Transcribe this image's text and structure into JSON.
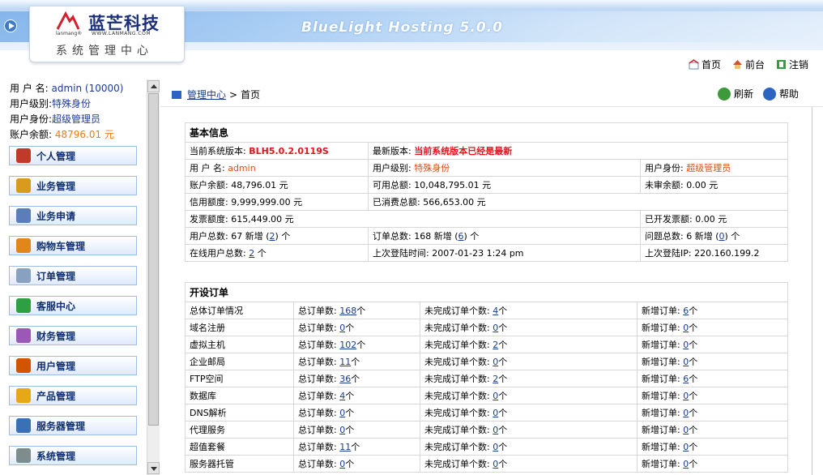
{
  "header": {
    "app_title": "BlueLight Hosting 5.0.0",
    "logo_brand": "蓝芒科技",
    "logo_small": "lanmang®",
    "logo_url": "WWW.LANMANG.COM",
    "logo_sub": "系统管理中心"
  },
  "top_links": [
    {
      "label": "首页",
      "icon": "home-icon"
    },
    {
      "label": "前台",
      "icon": "house-icon"
    },
    {
      "label": "注销",
      "icon": "logout-icon"
    }
  ],
  "sidebar": {
    "user": [
      {
        "label": "用 户 名:",
        "value": "admin (10000)"
      },
      {
        "label": "用户级别:",
        "value": "特殊身份"
      },
      {
        "label": "用户身份:",
        "value": "超级管理员"
      },
      {
        "label": "账户余额:",
        "value": "48796.01 元"
      }
    ],
    "menu": [
      {
        "label": "个人管理",
        "icon": "person-icon",
        "color": "#c0392b"
      },
      {
        "label": "业务管理",
        "icon": "box-icon",
        "color": "#d99b1e"
      },
      {
        "label": "业务申请",
        "icon": "hand-icon",
        "color": "#5c7db8"
      },
      {
        "label": "购物车管理",
        "icon": "cart-icon",
        "color": "#e0861a"
      },
      {
        "label": "订单管理",
        "icon": "notepad-icon",
        "color": "#8aa0bf"
      },
      {
        "label": "客服中心",
        "icon": "check-icon",
        "color": "#2ea043"
      },
      {
        "label": "财务管理",
        "icon": "money-icon",
        "color": "#9b59b6"
      },
      {
        "label": "用户管理",
        "icon": "users-icon",
        "color": "#d35400"
      },
      {
        "label": "产品管理",
        "icon": "award-icon",
        "color": "#e6a817"
      },
      {
        "label": "服务器管理",
        "icon": "server-icon",
        "color": "#3d6fb5"
      },
      {
        "label": "系统管理",
        "icon": "tools-icon",
        "color": "#7f8c8d"
      }
    ]
  },
  "breadcrumb": {
    "link": "管理中心",
    "sep": ">",
    "current": "首页"
  },
  "actions": [
    {
      "label": "刷新",
      "icon": "refresh-icon"
    },
    {
      "label": "帮助",
      "icon": "help-icon"
    }
  ],
  "basic_info": {
    "title": "基本信息",
    "cur_version_label": "当前系统版本:",
    "cur_version": "BLH5.0.2.0119S",
    "latest_label": "最新版本:",
    "latest": "当前系统版本已经是最新",
    "username_label": "用 户 名:",
    "username": "admin",
    "level_label": "用户级别:",
    "level": "特殊身份",
    "identity_label": "用户身份:",
    "identity": "超级管理员",
    "balance": "账户余额: 48,796.01 元",
    "available": "可用总额: 10,048,795.01 元",
    "unreviewed": "未审余额: 0.00 元",
    "credit": "信用额度: 9,999,999.00 元",
    "consumed": "已消费总额: 566,653.00 元",
    "invoice_limit": "发票额度: 615,449.00 元",
    "invoiced": "已开发票额: 0.00 元",
    "users_total_pre": "用户总数: 67  新增 (",
    "users_new": "2",
    "users_post": ") 个",
    "orders_total_pre": "订单总数: 168  新增 (",
    "orders_new": "6",
    "orders_post": ") 个",
    "issues_pre": "问题总数: 6  新增 (",
    "issues_new": "0",
    "issues_post": ") 个",
    "online_pre": "在线用户总数: ",
    "online": "2",
    "online_post": " 个",
    "last_login": "上次登陆时间: 2007-01-23 1:24 pm",
    "last_ip": "上次登陆IP: 220.160.199.2"
  },
  "orders": {
    "title": "开设订单",
    "total_label": "总订单数:",
    "pending_label": "未完成订单个数:",
    "new_label": "新增订单:",
    "unit": "个",
    "rows": [
      {
        "name": "总体订单情况",
        "total": "168",
        "pending": "4",
        "new": "6"
      },
      {
        "name": "域名注册",
        "total": "0",
        "pending": "0",
        "new": "0"
      },
      {
        "name": "虚拟主机",
        "total": "102",
        "pending": "2",
        "new": "0"
      },
      {
        "name": "企业邮局",
        "total": "11",
        "pending": "0",
        "new": "0"
      },
      {
        "name": "FTP空间",
        "total": "36",
        "pending": "2",
        "new": "6"
      },
      {
        "name": "数据库",
        "total": "4",
        "pending": "0",
        "new": "0"
      },
      {
        "name": "DNS解析",
        "total": "0",
        "pending": "0",
        "new": "0"
      },
      {
        "name": "代理服务",
        "total": "0",
        "pending": "0",
        "new": "0"
      },
      {
        "name": "超值套餐",
        "total": "11",
        "pending": "0",
        "new": "0"
      },
      {
        "name": "服务器托管",
        "total": "0",
        "pending": "0",
        "new": "0"
      }
    ]
  }
}
